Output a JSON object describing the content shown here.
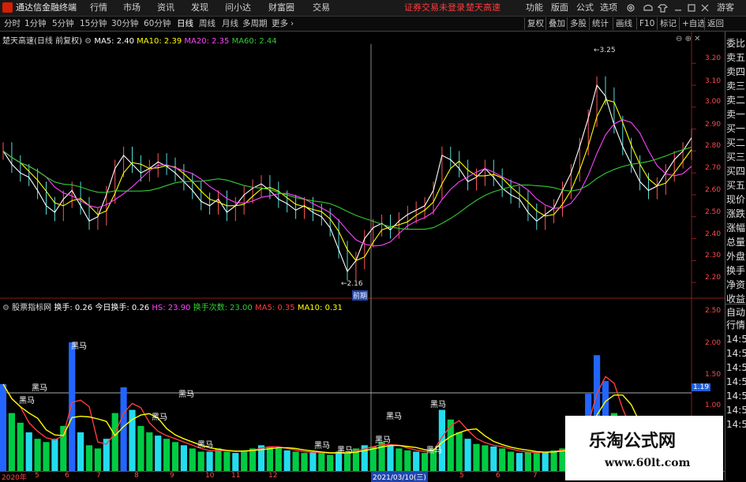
{
  "app": {
    "title": "通达信金融终端"
  },
  "menu": [
    "行情",
    "市场",
    "资讯",
    "发现",
    "问小达",
    "财富圈",
    "交易"
  ],
  "notice": {
    "login": "证券交易未登录",
    "speed": "楚天高速"
  },
  "top_right": [
    "功能",
    "版面",
    "公式",
    "选项"
  ],
  "guest": "游客",
  "periods": [
    "分时",
    "1分钟",
    "5分钟",
    "15分钟",
    "30分钟",
    "60分钟",
    "日线",
    "周线",
    "月线",
    "多周期",
    "更多"
  ],
  "period_active": "日线",
  "toolbar_buttons": [
    "复权",
    "叠加",
    "多股",
    "统计",
    "画线",
    "F10",
    "标记",
    "+自选",
    "返回"
  ],
  "main_legend": {
    "title": "楚天高速(日线 前复权)",
    "ma5": "MA5: 2.40",
    "ma10": "MA10: 2.39",
    "ma20": "MA20: 2.35",
    "ma60": "MA60: 2.44"
  },
  "price_axis": [
    "3.20",
    "3.10",
    "3.00",
    "2.90",
    "2.80",
    "2.70",
    "2.60",
    "2.50",
    "2.40",
    "2.30",
    "2.20"
  ],
  "annotations": {
    "high": "3.25",
    "low": "2.16",
    "low_tag": "前期"
  },
  "sub_legend": {
    "title": "股票指标网",
    "hs": "换手: 0.26",
    "today": "今日换手: 0.26",
    "hs2": "HS: 23.90",
    "count": "换手次数: 23.00",
    "ma5": "MA5: 0.35",
    "ma10": "MA10: 0.31"
  },
  "sub_axis": [
    "2.50",
    "2.00",
    "1.50",
    "1.00"
  ],
  "sub_marker": "1.19",
  "heima": [
    "黑马",
    "黑马",
    "黑马",
    "黑马",
    "黑马",
    "黑马",
    "黑马",
    "黑马",
    "黑马",
    "黑马",
    "黑马",
    "黑马"
  ],
  "right_panel": [
    "委比",
    "卖五",
    "卖四",
    "卖三",
    "卖二",
    "卖一",
    "买一",
    "买二",
    "买三",
    "买四",
    "买五",
    "现价",
    "涨跌",
    "涨幅",
    "总量",
    "外盘",
    "换手",
    "净资",
    "收益"
  ],
  "right_panel_lower": [
    "自动",
    "行情",
    "14:5",
    "14:5",
    "14:5",
    "14:5",
    "14:5",
    "14:5",
    "14:5"
  ],
  "dates": [
    "2020年",
    "5",
    "6",
    "7",
    "8",
    "9",
    "10",
    "11",
    "12",
    "2021/03/10(三)",
    "5",
    "6",
    "7",
    "8"
  ],
  "watermark": {
    "cn": "乐淘公式网",
    "url": "www.60lt.com"
  },
  "colors": {
    "up": "#ff3b3b",
    "ma5": "#ffffff",
    "ma10": "#ffff00",
    "ma20": "#ff44ff",
    "ma60": "#33cc33",
    "vol_green": "#00cc44",
    "vol_cyan": "#22ddee",
    "vol_blue": "#2266ff"
  },
  "chart_data": {
    "type": "line",
    "title": "楚天高速(日线 前复权)",
    "ylim": [
      2.15,
      3.28
    ],
    "close": [
      2.8,
      2.74,
      2.7,
      2.68,
      2.62,
      2.55,
      2.52,
      2.58,
      2.62,
      2.55,
      2.48,
      2.5,
      2.6,
      2.72,
      2.78,
      2.74,
      2.7,
      2.72,
      2.75,
      2.73,
      2.7,
      2.66,
      2.62,
      2.57,
      2.55,
      2.58,
      2.52,
      2.55,
      2.6,
      2.63,
      2.65,
      2.62,
      2.58,
      2.56,
      2.53,
      2.55,
      2.52,
      2.5,
      2.45,
      2.35,
      2.25,
      2.3,
      2.4,
      2.45,
      2.47,
      2.44,
      2.48,
      2.51,
      2.53,
      2.55,
      2.62,
      2.78,
      2.76,
      2.72,
      2.66,
      2.68,
      2.72,
      2.68,
      2.63,
      2.6,
      2.58,
      2.52,
      2.48,
      2.51,
      2.54,
      2.62,
      2.7,
      2.82,
      2.95,
      3.1,
      3.05,
      2.92,
      2.82,
      2.74,
      2.66,
      2.62,
      2.64,
      2.7,
      2.76,
      2.8,
      2.86
    ],
    "volume": [
      1.35,
      0.9,
      0.75,
      0.6,
      0.5,
      0.45,
      0.5,
      0.7,
      2.0,
      0.6,
      0.4,
      0.35,
      0.5,
      0.9,
      1.3,
      0.95,
      0.7,
      0.6,
      0.55,
      0.5,
      0.45,
      0.4,
      0.35,
      0.3,
      0.3,
      0.35,
      0.3,
      0.28,
      0.32,
      0.35,
      0.4,
      0.38,
      0.35,
      0.32,
      0.3,
      0.28,
      0.3,
      0.28,
      0.25,
      0.3,
      0.28,
      0.35,
      0.4,
      0.38,
      0.45,
      0.4,
      0.35,
      0.32,
      0.3,
      0.28,
      0.35,
      0.95,
      0.8,
      0.6,
      0.5,
      0.42,
      0.4,
      0.38,
      0.35,
      0.3,
      0.28,
      0.3,
      0.28,
      0.3,
      0.32,
      0.35,
      0.4,
      0.6,
      1.2,
      1.8,
      1.4,
      0.9,
      0.6,
      0.45,
      0.4,
      0.35,
      0.38,
      0.4,
      0.45,
      0.5,
      0.4
    ],
    "series": [
      {
        "name": "MA5",
        "color": "#ffffff"
      },
      {
        "name": "MA10",
        "color": "#ffff00"
      },
      {
        "name": "MA20",
        "color": "#ff44ff"
      },
      {
        "name": "MA60",
        "color": "#33cc33"
      }
    ]
  }
}
